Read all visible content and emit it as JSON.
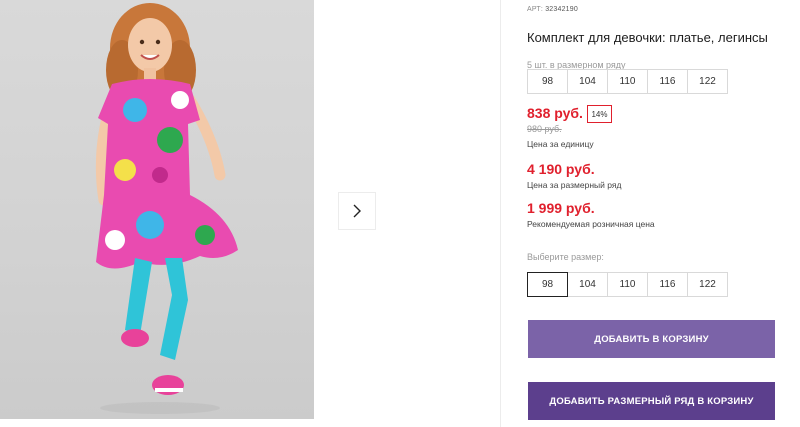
{
  "product": {
    "article_label": "АРТ:",
    "article_value": "32342190",
    "title": "Комплект для девочки: платье, легинсы"
  },
  "row_info": {
    "label": "5 шт. в размерном ряду",
    "sizes": [
      "98",
      "104",
      "110",
      "116",
      "122"
    ]
  },
  "prices": {
    "unit_price": "838 руб.",
    "discount": "14%",
    "old_price": "980 руб.",
    "unit_caption": "Цена за единицу",
    "row_price": "4 190 руб.",
    "row_caption": "Цена за размерный ряд",
    "rrp": "1 999 руб.",
    "rrp_caption": "Рекомендуемая розничная цена"
  },
  "size_select": {
    "label": "Выберите размер:",
    "options": [
      "98",
      "104",
      "110",
      "116",
      "122"
    ],
    "selected": "98"
  },
  "buttons": {
    "add_to_cart": "Добавить в корзину",
    "add_row_to_cart": "Добавить размерный ряд в корзину"
  },
  "colors": {
    "price_red": "#e0202d",
    "button_primary": "#7b63a8",
    "button_secondary": "#5c3f8d"
  },
  "icons": {
    "next": "chevron-right-icon"
  }
}
